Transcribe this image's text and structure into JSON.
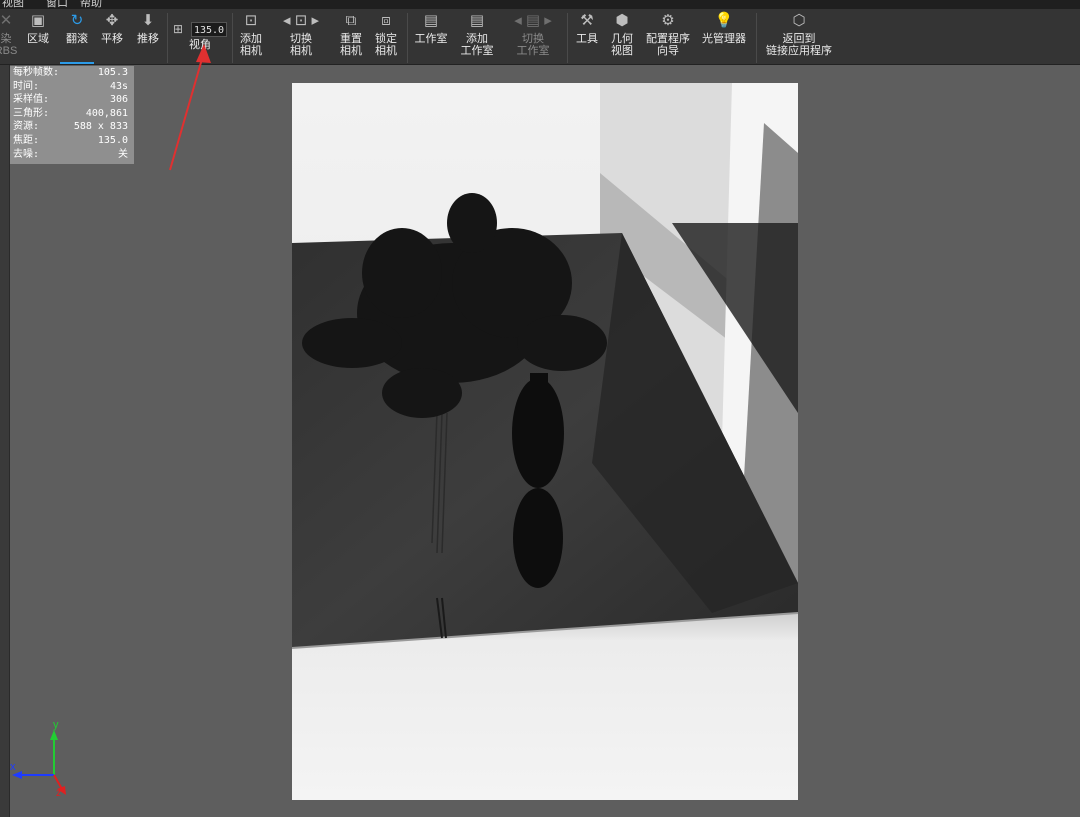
{
  "menu": [
    "视图",
    "窗口",
    "帮助"
  ],
  "toolbar": {
    "items": [
      {
        "label": "染\nRBS",
        "icon": "render-icon"
      },
      {
        "label": "区域",
        "icon": "region-icon"
      },
      {
        "label": "翻滚",
        "icon": "tumble-icon"
      },
      {
        "label": "平移",
        "icon": "pan-icon"
      },
      {
        "label": "推移",
        "icon": "dolly-icon"
      },
      {
        "label": "视角",
        "icon": "field-of-view-icon"
      },
      {
        "label": "添加\n相机",
        "icon": "add-camera-icon"
      },
      {
        "label": "切换\n相机",
        "icon": "switch-camera-icon"
      },
      {
        "label": "重置\n相机",
        "icon": "reset-camera-icon"
      },
      {
        "label": "锁定\n相机",
        "icon": "lock-camera-icon"
      },
      {
        "label": "工作室",
        "icon": "studio-icon"
      },
      {
        "label": "添加\n工作室",
        "icon": "add-studio-icon"
      },
      {
        "label": "切换\n工作室",
        "icon": "switch-studio-icon"
      },
      {
        "label": "工具",
        "icon": "tools-icon"
      },
      {
        "label": "几何\n视图",
        "icon": "geometry-view-icon"
      },
      {
        "label": "配置程序\n向导",
        "icon": "configurator-wizard-icon"
      },
      {
        "label": "光管理器",
        "icon": "light-manager-icon"
      },
      {
        "label": "返回到\n链接应用程序",
        "icon": "return-link-icon"
      }
    ],
    "fov_value": "135.0",
    "active": "翻滚",
    "accent": "#2c9be8"
  },
  "stats": [
    {
      "label": "每秒帧数:",
      "value": "105.3"
    },
    {
      "label": "时间:",
      "value": "43s"
    },
    {
      "label": "采样值:",
      "value": "306"
    },
    {
      "label": "三角形:",
      "value": "400,861"
    },
    {
      "label": "资源:",
      "value": "588 x 833"
    },
    {
      "label": "焦距:",
      "value": "135.0"
    },
    {
      "label": "去噪:",
      "value": "关"
    }
  ],
  "axis": {
    "x_label": "x",
    "y_label": "y",
    "z_label": "z",
    "x_color": "#1e3cff",
    "y_color": "#22cc33",
    "z_color": "#e02020"
  }
}
